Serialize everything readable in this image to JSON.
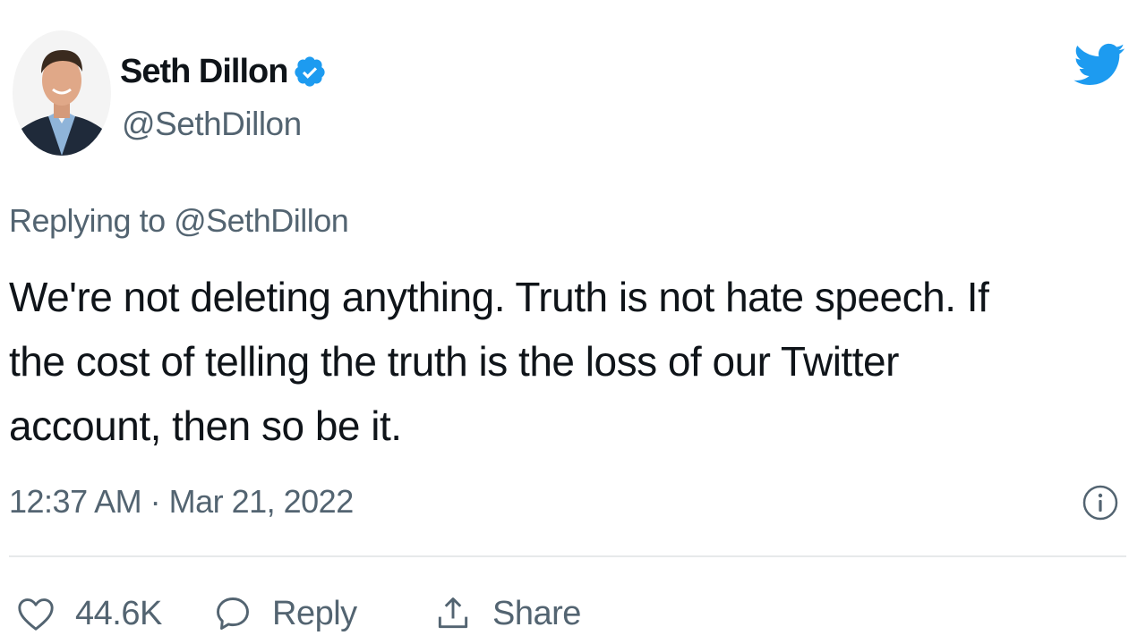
{
  "author": {
    "display_name": "Seth Dillon",
    "handle": "@SethDillon",
    "verified": true
  },
  "replying_to": "Replying to @SethDillon",
  "tweet": {
    "lines": [
      "We're not deleting anything. Truth is not hate speech. If",
      "the cost of telling the truth is the loss of our Twitter",
      "account, then so be it."
    ],
    "timestamp": "12:37 AM · Mar 21, 2022"
  },
  "actions": {
    "like_count": "44.6K",
    "reply_label": "Reply",
    "share_label": "Share"
  },
  "icons": {
    "brand": "twitter-bird-icon",
    "verified": "verified-badge-icon",
    "info": "info-icon",
    "like": "heart-icon",
    "reply": "speech-bubble-icon",
    "share": "share-upload-icon"
  },
  "colors": {
    "twitter_blue": "#1d9bf0",
    "text_primary": "#0f1419",
    "text_secondary": "#536471",
    "divider": "#e7e9ea"
  }
}
